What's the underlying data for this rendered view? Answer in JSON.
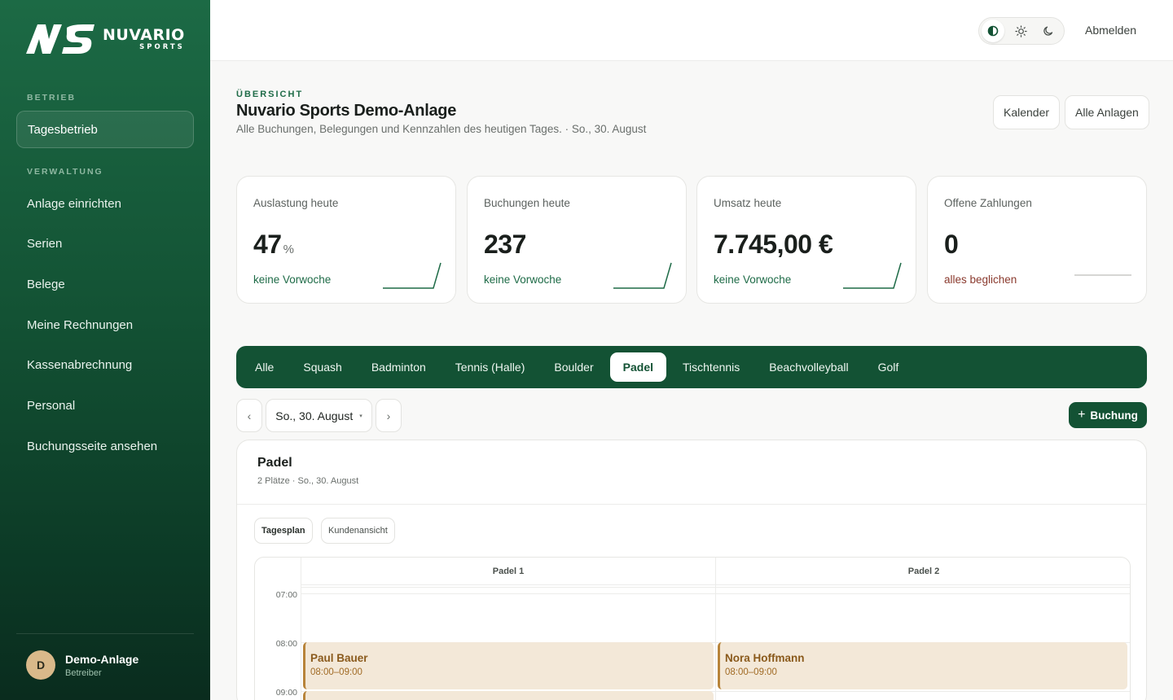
{
  "brand": {
    "name": "NUVARIO",
    "sub": "SPORTS"
  },
  "sidebar": {
    "sections": [
      {
        "label": "BETRIEB",
        "items": [
          {
            "label": "Tagesbetrieb",
            "active": true
          }
        ]
      },
      {
        "label": "VERWALTUNG",
        "items": [
          {
            "label": "Anlage einrichten"
          },
          {
            "label": "Serien"
          },
          {
            "label": "Belege"
          },
          {
            "label": "Meine Rechnungen"
          },
          {
            "label": "Kassenabrechnung"
          },
          {
            "label": "Personal"
          },
          {
            "label": "Buchungsseite ansehen"
          }
        ]
      }
    ],
    "user": {
      "initial": "D",
      "name": "Demo-Anlage",
      "role": "Betreiber"
    }
  },
  "topbar": {
    "theme_options": [
      "contrast-icon",
      "sun-icon",
      "moon-icon"
    ],
    "logout_label": "Abmelden"
  },
  "header": {
    "eyebrow": "ÜBERSICHT",
    "title": "Nuvario Sports Demo-Anlage",
    "subtitle": "Alle Buchungen, Belegungen und Kennzahlen des heutigen Tages. · So., 30. August",
    "calendar_button": "Kalender",
    "all_facilities_button": "Alle Anlagen"
  },
  "kpis": [
    {
      "label": "Auslastung heute",
      "value": "47",
      "unit": "%",
      "note": "keine Vorwoche",
      "trend": "up"
    },
    {
      "label": "Buchungen heute",
      "value": "237",
      "unit": "",
      "note": "keine Vorwoche",
      "trend": "up"
    },
    {
      "label": "Umsatz heute",
      "value": "7.745,00 €",
      "unit": "",
      "note": "keine Vorwoche",
      "trend": "up"
    },
    {
      "label": "Offene Zahlungen",
      "value": "0",
      "unit": "",
      "note": "alles beglichen",
      "trend": "flat"
    }
  ],
  "sport_tabs": {
    "items": [
      "Alle",
      "Squash",
      "Badminton",
      "Tennis (Halle)",
      "Boulder",
      "Padel",
      "Tischtennis",
      "Beachvolleyball",
      "Golf"
    ],
    "active": "Padel"
  },
  "date_bar": {
    "prev": "‹",
    "date": "So., 30. August",
    "caret": "▾",
    "next": "›",
    "add_booking": "Buchung",
    "add_icon": "+"
  },
  "panel": {
    "title": "Padel",
    "subtitle": "2 Plätze · So., 30. August",
    "views": [
      "Tagesplan",
      "Kundenansicht"
    ],
    "active_view": "Tagesplan",
    "courts": [
      "Padel 1",
      "Padel 2"
    ],
    "times": [
      "07:00",
      "08:00",
      "09:00"
    ],
    "bookings": [
      {
        "court": "Padel 1",
        "name": "Paul Bauer",
        "time": "08:00–09:00"
      },
      {
        "court": "Padel 2",
        "name": "Nora Hoffmann",
        "time": "08:00–09:00"
      }
    ]
  },
  "colors": {
    "brand_green": "#135234",
    "accent_green": "#1e6b47",
    "booking_bg": "#f3e8d8",
    "booking_border": "#b8843a",
    "warn_text": "#8a3a2e"
  }
}
